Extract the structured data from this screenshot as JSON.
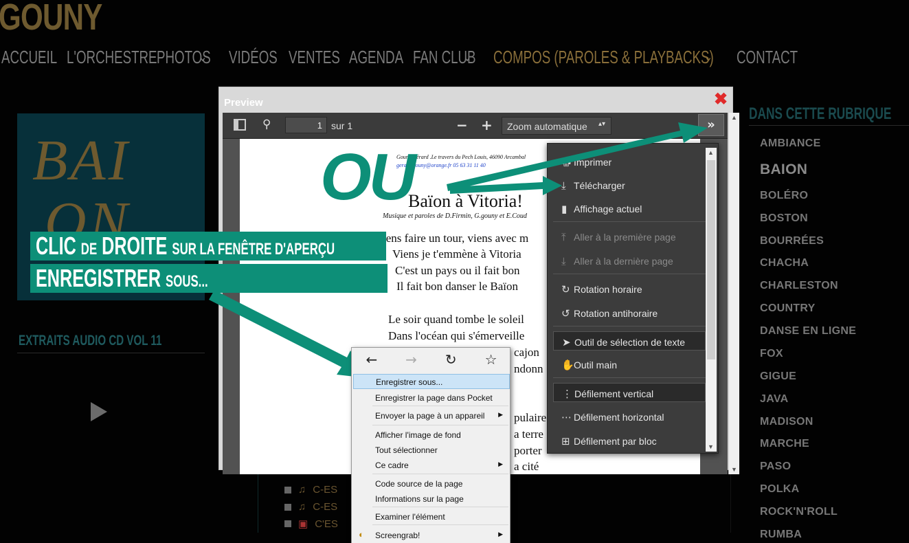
{
  "site": {
    "logo": "GOUNY",
    "nav": [
      "ACCUEIL",
      "L'ORCHESTRE",
      "PHOTOS",
      "VIDÉOS",
      "VENTES",
      "AGENDA",
      "FAN CLUB",
      "COMPOS (PAROLES & PLAYBACKS)",
      "CONTACT"
    ],
    "album_letters_1": "BAI",
    "album_letters_2": "ON",
    "extraits_title": "EXTRAITS AUDIO CD VOL 11",
    "tracks": [
      "C-ES",
      "C-ES",
      "C'ES"
    ]
  },
  "sidebar": {
    "title": "DANS CETTE RUBRIQUE",
    "items": [
      "AMBIANCE",
      "BAION",
      "BOLÉRO",
      "BOSTON",
      "BOURRÉES",
      "CHACHA",
      "CHARLESTON",
      "COUNTRY",
      "DANSE EN LIGNE",
      "FOX",
      "GIGUE",
      "JAVA",
      "MADISON",
      "MARCHE",
      "PASO",
      "POLKA",
      "ROCK'N'ROLL",
      "RUMBA"
    ]
  },
  "preview": {
    "title": "Preview",
    "close": "✖",
    "page_number": "1",
    "page_total": "sur 1",
    "zoom": "Zoom automatique",
    "more": "»"
  },
  "pdf": {
    "header_line1": "Gouny Gérard  .Le travers du Pech Louis, 46090 Arcambal",
    "header_line2": "gerard.gouny@orange.fr   05 63 31 11 40",
    "title": "Baïon à Vitoria!",
    "credits": "Musique  et paroles de D.Firmin, G.gouny et E.Coud",
    "lines": [
      "iens faire un tour, viens avec m",
      "Viens je t'emmène à Vitoria",
      "C'est un pays ou il fait bon",
      "Il fait bon danser le Baïon",
      "Le soir quand tombe le soleil",
      "Dans l'océan qui s'émerveille",
      "cajon",
      "ndonn",
      "pulaire",
      "a terre",
      "porter",
      "a cité"
    ]
  },
  "tools_menu": {
    "items": [
      {
        "icon": "print-icon",
        "glyph": "🖶",
        "label": "Imprimer",
        "disabled": false
      },
      {
        "icon": "download-icon",
        "glyph": "⤓",
        "label": "Télécharger",
        "disabled": false
      },
      {
        "icon": "bookmark-icon",
        "glyph": "▮",
        "label": "Affichage actuel",
        "disabled": false
      },
      {
        "icon": "first-page-icon",
        "glyph": "⤒",
        "label": "Aller à la première page",
        "disabled": true
      },
      {
        "icon": "last-page-icon",
        "glyph": "⤓",
        "label": "Aller à la dernière page",
        "disabled": true
      },
      {
        "icon": "rotate-cw-icon",
        "glyph": "↻",
        "label": "Rotation horaire",
        "disabled": false
      },
      {
        "icon": "rotate-ccw-icon",
        "glyph": "↺",
        "label": "Rotation antihoraire",
        "disabled": false
      },
      {
        "icon": "cursor-icon",
        "glyph": "➤",
        "label": "Outil de sélection de texte",
        "disabled": false
      },
      {
        "icon": "hand-icon",
        "glyph": "✋",
        "label": "Outil main",
        "disabled": false
      },
      {
        "icon": "vertical-scroll-icon",
        "glyph": "⋮",
        "label": "Défilement vertical",
        "disabled": false
      },
      {
        "icon": "horizontal-scroll-icon",
        "glyph": "⋯",
        "label": "Défilement horizontal",
        "disabled": false
      },
      {
        "icon": "wrapped-scroll-icon",
        "glyph": "⊞",
        "label": "Défilement par bloc",
        "disabled": false
      }
    ]
  },
  "context_menu": {
    "nav": {
      "back": "←",
      "forward": "→",
      "reload": "↻",
      "bookmark": "☆"
    },
    "items": [
      {
        "label": "Enregistrer sous...",
        "submenu": false
      },
      {
        "label": "Enregistrer la page dans Pocket",
        "submenu": false
      },
      {
        "label": "Envoyer la page à un appareil",
        "submenu": true
      },
      {
        "label": "Afficher l'image de fond",
        "submenu": false
      },
      {
        "label": "Tout sélectionner",
        "submenu": false
      },
      {
        "label": "Ce cadre",
        "submenu": true
      },
      {
        "label": "Code source de la page",
        "submenu": false
      },
      {
        "label": "Informations sur la page",
        "submenu": false
      },
      {
        "label": "Examiner l'élément",
        "submenu": false
      },
      {
        "label": "Screengrab!",
        "submenu": true
      }
    ]
  },
  "annotation": {
    "ou": "OU",
    "line1_big1": "CLIC",
    "line1_small1": "DE",
    "line1_big2": "DROITE",
    "line1_small2": "SUR LA FENÊTRE D'APERÇU",
    "line2_big": "ENREGISTRER",
    "line2_small": "SOUS...",
    "accent_color": "#0d8f78"
  }
}
